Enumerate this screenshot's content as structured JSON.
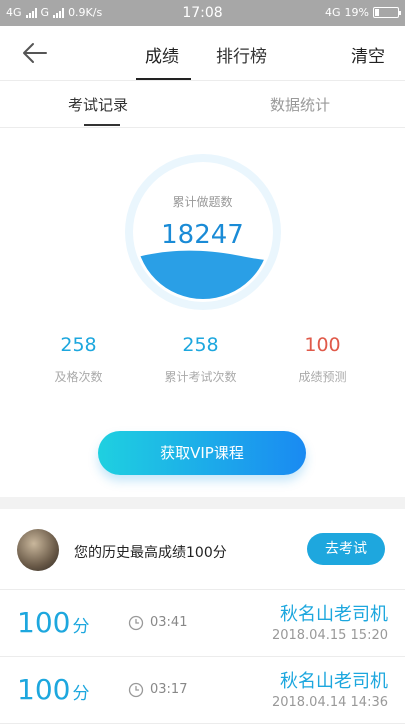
{
  "status_bar": {
    "left_text": "4G",
    "left_text2": "G",
    "speed": "0.9K/s",
    "time": "17:08",
    "network": "4G",
    "battery_pct": "19%",
    "battery_level": 0.19
  },
  "nav": {
    "tabs": [
      {
        "label": "成绩"
      },
      {
        "label": "排行榜"
      }
    ],
    "clear_label": "清空"
  },
  "subtabs": [
    {
      "label": "考试记录"
    },
    {
      "label": "数据统计"
    }
  ],
  "summary": {
    "gauge_label": "累计做题数",
    "gauge_value": "18247",
    "stats": [
      {
        "value": "258",
        "label": "及格次数",
        "color": "#1da7de"
      },
      {
        "value": "258",
        "label": "累计考试次数",
        "color": "#1da7de"
      },
      {
        "value": "100",
        "label": "成绩预测",
        "color": "#e05a4a"
      }
    ]
  },
  "vip_button": "获取VIP课程",
  "best": {
    "text": "您的历史最高成绩100分",
    "button": "去考试"
  },
  "records": [
    {
      "score": "100",
      "unit": "分",
      "duration": "03:41",
      "name": "秋名山老司机",
      "date": "2018.04.15  15:20"
    },
    {
      "score": "100",
      "unit": "分",
      "duration": "03:17",
      "name": "秋名山老司机",
      "date": "2018.04.14  14:36"
    }
  ],
  "colors": {
    "accent": "#1da7de",
    "status_bar": "#a7a7a7"
  }
}
